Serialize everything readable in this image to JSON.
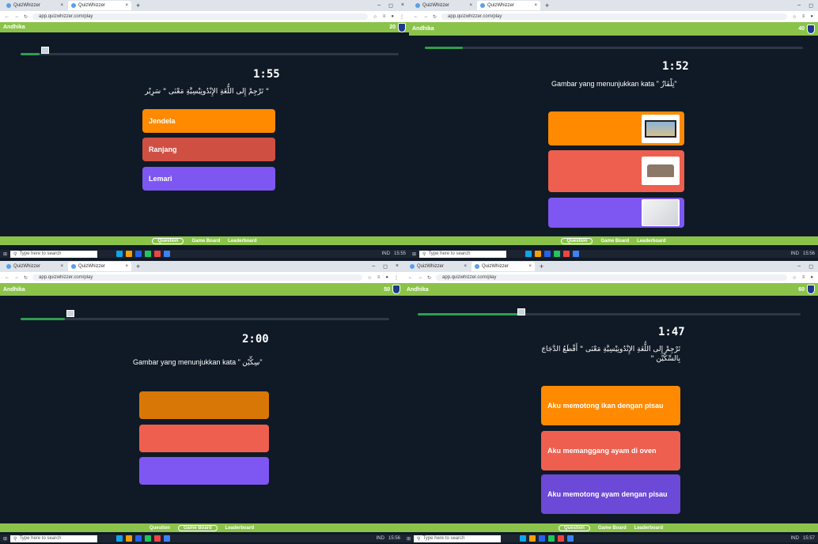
{
  "browser": {
    "tab1": "QuizWhizzer",
    "tab2": "QuizWhizzer",
    "url": "app.quizwhizzer.com/play",
    "newtab": "+",
    "win_min": "–",
    "win_max": "◻",
    "win_close": "×"
  },
  "game": {
    "player": "Andhika",
    "nav_question": "Question",
    "nav_board": "Game Board",
    "nav_leaderboard": "Leaderboard"
  },
  "taskbar": {
    "search_placeholder": "Type here to search",
    "lang": "IND"
  },
  "panels": [
    {
      "score": "20",
      "timer": "1:55",
      "progress": 0.05,
      "question": "\" تَرْجِمْ إِلى اللُّغَةِ الإِنْدُونِيْسِيَّةِ مَعْنَى \" سَرِيْر",
      "options": [
        "Jendela",
        "Ranjang",
        "Lemari"
      ],
      "time": "15:55"
    },
    {
      "score": "40",
      "timer": "1:52",
      "progress": 0.1,
      "question": "Gambar yang menunjukkan kata \" تِلْفَازٌ\"",
      "options": [
        "tv-image",
        "sofa-image",
        "blank-image"
      ],
      "time": "15:56"
    },
    {
      "score": "50",
      "timer": "2:00",
      "progress": 0.12,
      "question": "Gambar yang menunjukkan kata \" سِكِّيْن\"",
      "options": [
        "",
        "",
        ""
      ],
      "time": "15:56"
    },
    {
      "score": "60",
      "timer": "1:47",
      "progress": 0.27,
      "question": "تَرْجِمْ إِلى اللُّغَةِ الإِنْدُونِيْسِيَّةِ مَعْنَى \" أَقْطَعُ الدَّجَاجَ بِالسِّكِّيْن \"",
      "options": [
        "Aku memotong ikan dengan pisau",
        "Aku memanggang ayam di oven",
        "Aku memotong ayam dengan pisau"
      ],
      "time": "15:57"
    }
  ]
}
